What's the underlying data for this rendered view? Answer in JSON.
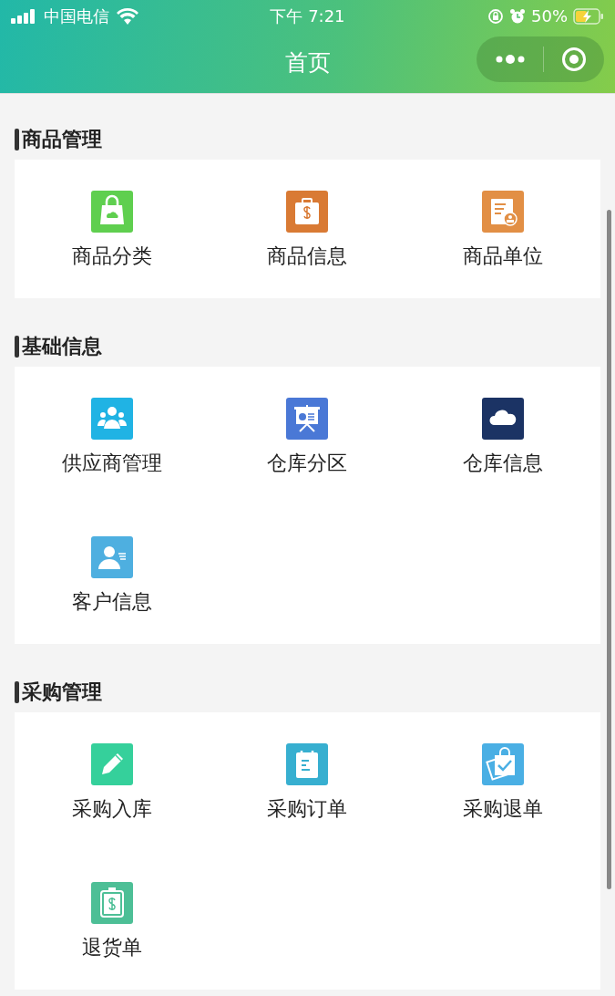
{
  "status_bar": {
    "carrier": "中国电信",
    "time": "下午 7:21",
    "battery": "50%"
  },
  "nav": {
    "title": "首页"
  },
  "sections": [
    {
      "title": "商品管理",
      "items": [
        {
          "label": "商品分类",
          "kind": "bag",
          "color": "#5fcf4f"
        },
        {
          "label": "商品信息",
          "kind": "moneybag",
          "color": "#d97a34"
        },
        {
          "label": "商品单位",
          "kind": "stamp",
          "color": "#e28f45"
        }
      ]
    },
    {
      "title": "基础信息",
      "items": [
        {
          "label": "供应商管理",
          "kind": "people",
          "color": "#20b3e4"
        },
        {
          "label": "仓库分区",
          "kind": "board",
          "color": "#4a78d6"
        },
        {
          "label": "仓库信息",
          "kind": "cloud",
          "color": "#1b3364"
        },
        {
          "label": "客户信息",
          "kind": "contact",
          "color": "#4eafe0"
        }
      ]
    },
    {
      "title": "采购管理",
      "items": [
        {
          "label": "采购入库",
          "kind": "pencil",
          "color": "#35d09b"
        },
        {
          "label": "采购订单",
          "kind": "notepad",
          "color": "#37afd0"
        },
        {
          "label": "采购退单",
          "kind": "check",
          "color": "#4aafe4"
        },
        {
          "label": "退货单",
          "kind": "clipboard",
          "color": "#4dbf96"
        }
      ]
    }
  ]
}
